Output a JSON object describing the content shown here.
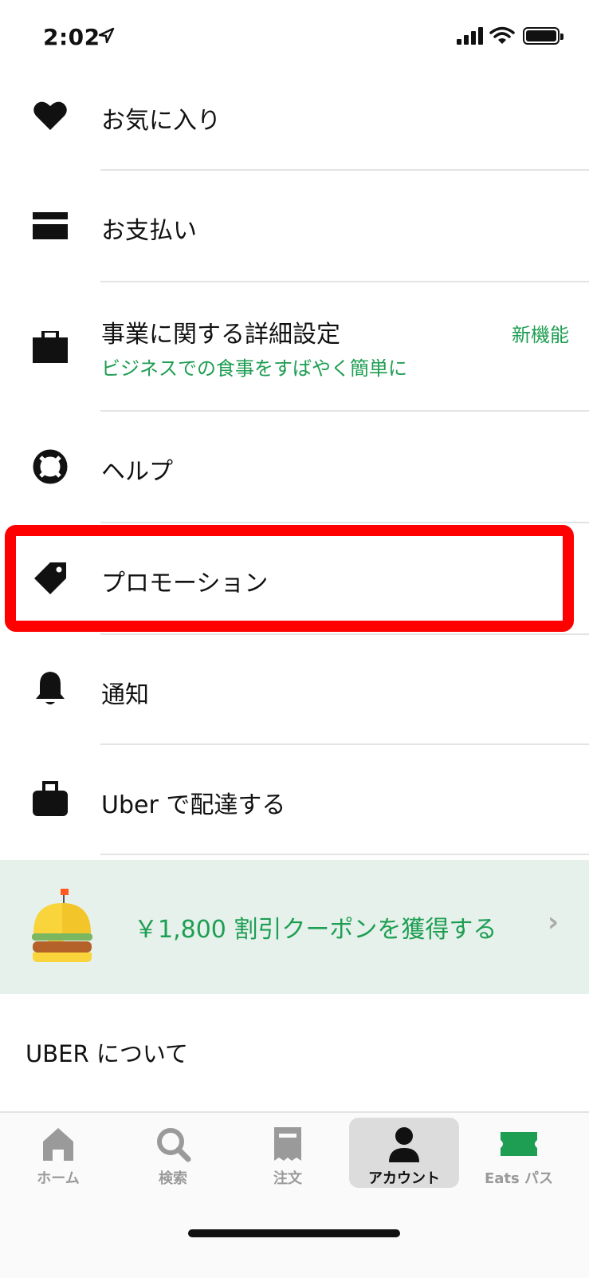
{
  "status_bar": {
    "time": "2:02"
  },
  "menu": {
    "items": [
      {
        "label": "お気に入り"
      },
      {
        "label": "お支払い"
      },
      {
        "label": "事業に関する詳細設定",
        "subtitle": "ビジネスでの食事をすばやく簡単に",
        "badge": "新機能"
      },
      {
        "label": "ヘルプ"
      },
      {
        "label": "プロモーション"
      },
      {
        "label": "通知"
      },
      {
        "label": "Uber で配達する"
      }
    ]
  },
  "promo": {
    "text": "￥1,800 割引クーポンを獲得する",
    "chevron": "›"
  },
  "about": {
    "label": "UBER について"
  },
  "tabs": [
    {
      "label": "ホーム",
      "icon": "home-icon"
    },
    {
      "label": "検索",
      "icon": "search-icon"
    },
    {
      "label": "注文",
      "icon": "receipt-icon"
    },
    {
      "label": "アカウント",
      "icon": "person-icon",
      "active": true
    },
    {
      "label": "Eats パス",
      "icon": "ticket-icon"
    }
  ],
  "colors": {
    "accent": "#1e9e52",
    "highlight": "#ff0000",
    "promo_bg": "#e6f1ec"
  }
}
